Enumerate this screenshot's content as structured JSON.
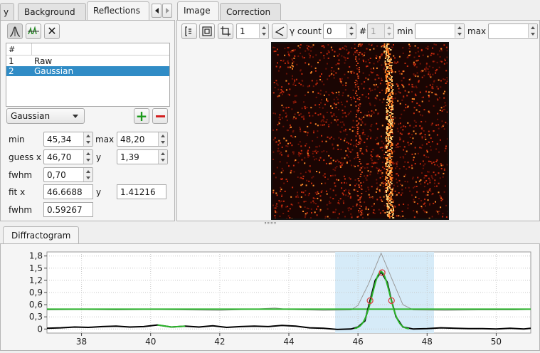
{
  "left_tabs": [
    {
      "label": "y"
    },
    {
      "label": "Background"
    },
    {
      "label": "Reflections",
      "active": true
    }
  ],
  "right_tabs": [
    {
      "label": "Image",
      "active": true
    },
    {
      "label": "Correction"
    }
  ],
  "reflection_list": {
    "headers": [
      "#",
      ""
    ],
    "rows": [
      {
        "num": "1",
        "name": "Raw",
        "selected": false
      },
      {
        "num": "2",
        "name": "Gaussian",
        "selected": true
      }
    ]
  },
  "peak_type": "Gaussian",
  "params": {
    "min_label": "min",
    "min_value": "45,34",
    "max_label": "max",
    "max_value": "48,20",
    "guess_x_label": "guess x",
    "guess_x_value": "46,70",
    "guess_y_label": "y",
    "guess_y_value": "1,39",
    "fwhm_label": "fwhm",
    "fwhm_value": "0,70",
    "fit_x_label": "fit x",
    "fit_x_value": "46.6688",
    "fit_y_label": "y",
    "fit_y_value": "1.41216",
    "fit_fwhm_label": "fwhm",
    "fit_fwhm_value": "0.59267"
  },
  "image_toolbar": {
    "index_value": "1",
    "gamma_label": "γ count",
    "gamma_value": "0",
    "hash_label": "#",
    "hash_value": "1",
    "min_label": "min",
    "max_label": "max"
  },
  "bottom_tab": "Diffractogram",
  "colors": {
    "selection": "#308cc6",
    "range_band": "#d6ebf8",
    "fit_line": "#2bb52b",
    "raw_line": "#000000",
    "guess_marker": "#d94545",
    "add": "#1a9a1a",
    "remove": "#d42020"
  },
  "chart_data": {
    "type": "line",
    "xlim": [
      37,
      51
    ],
    "ylim": [
      -0.1,
      1.9
    ],
    "x_ticks": [
      38,
      40,
      42,
      44,
      46,
      48,
      50
    ],
    "y_ticks": [
      0,
      0.3,
      0.6,
      0.9,
      1.2,
      1.5,
      1.8
    ],
    "y_tick_labels": [
      "0",
      "0,3",
      "0,6",
      "0,9",
      "1,2",
      "1,5",
      "1,8"
    ],
    "range_band": [
      45.34,
      48.2
    ],
    "background_level": 0.49,
    "fit": {
      "center": 46.6688,
      "height": 1.41216,
      "fwhm": 0.59267
    },
    "guess_markers": [
      {
        "x": 46.35,
        "y": 0.7
      },
      {
        "x": 46.7,
        "y": 1.39
      },
      {
        "x": 46.97,
        "y": 0.7
      }
    ],
    "series": [
      {
        "values": [
          [
            37.0,
            0.02
          ],
          [
            37.4,
            0.03
          ],
          [
            37.8,
            0.05
          ],
          [
            38.2,
            0.04
          ],
          [
            38.6,
            0.06
          ],
          [
            39.0,
            0.07
          ],
          [
            39.4,
            0.05
          ],
          [
            39.8,
            0.06
          ],
          [
            40.2,
            0.1
          ],
          [
            40.6,
            0.05
          ],
          [
            41.0,
            0.07
          ],
          [
            41.4,
            0.05
          ],
          [
            41.8,
            0.08
          ],
          [
            42.2,
            0.04
          ],
          [
            42.6,
            0.06
          ],
          [
            43.0,
            0.07
          ],
          [
            43.4,
            0.06
          ],
          [
            43.8,
            0.09
          ],
          [
            44.2,
            0.07
          ],
          [
            44.6,
            0.03
          ],
          [
            45.0,
            0.02
          ],
          [
            45.4,
            -0.01
          ],
          [
            45.8,
            0.0
          ],
          [
            46.0,
            0.05
          ],
          [
            46.2,
            0.2
          ],
          [
            46.35,
            0.7
          ],
          [
            46.5,
            1.2
          ],
          [
            46.67,
            1.41
          ],
          [
            46.85,
            1.15
          ],
          [
            46.97,
            0.7
          ],
          [
            47.1,
            0.3
          ],
          [
            47.3,
            0.05
          ],
          [
            47.6,
            0.0
          ],
          [
            48.0,
            0.01
          ],
          [
            48.4,
            0.03
          ],
          [
            48.8,
            0.02
          ],
          [
            49.2,
            0.01
          ],
          [
            49.6,
            0.01
          ],
          [
            50.0,
            0.0
          ],
          [
            50.4,
            0.02
          ],
          [
            50.8,
            0.0
          ],
          [
            51.0,
            0.02
          ]
        ]
      },
      {
        "values": [
          [
            37.0,
            0.47
          ],
          [
            38.0,
            0.48
          ],
          [
            39.0,
            0.47
          ],
          [
            40.0,
            0.48
          ],
          [
            41.0,
            0.47
          ],
          [
            42.0,
            0.46
          ],
          [
            43.0,
            0.49
          ],
          [
            43.6,
            0.52
          ],
          [
            44.0,
            0.48
          ],
          [
            45.0,
            0.46
          ],
          [
            45.8,
            0.47
          ],
          [
            46.0,
            0.58
          ],
          [
            46.3,
            1.1
          ],
          [
            46.67,
            1.87
          ],
          [
            47.0,
            1.2
          ],
          [
            47.3,
            0.6
          ],
          [
            47.6,
            0.47
          ],
          [
            48.5,
            0.46
          ],
          [
            49.5,
            0.47
          ],
          [
            50.5,
            0.47
          ],
          [
            51.0,
            0.48
          ]
        ]
      }
    ]
  }
}
